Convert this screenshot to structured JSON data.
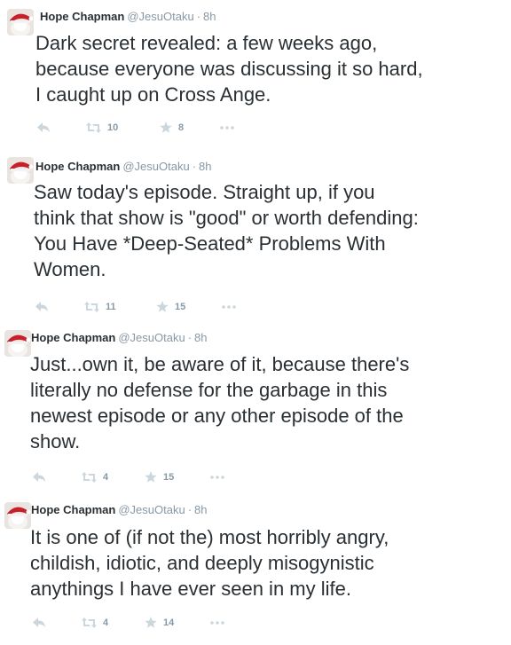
{
  "tweets": [
    {
      "name": "Hope Chapman",
      "handle": "@JesuOtaku",
      "dot": "·",
      "time": "8h",
      "text": "Dark secret revealed: a few weeks ago,\nbecause everyone was discussing it so hard,\nI caught up on Cross Ange.",
      "retweets": "10",
      "favorites": "8"
    },
    {
      "name": "Hope Chapman",
      "handle": "@JesuOtaku",
      "dot": "·",
      "time": "8h",
      "text": "Saw today's episode. Straight up, if you\nthink that show is \"good\" or worth defending:\nYou Have *Deep-Seated* Problems With\nWomen.",
      "retweets": "11",
      "favorites": "15"
    },
    {
      "name": "Hope Chapman",
      "handle": "@JesuOtaku",
      "dot": "·",
      "time": "8h",
      "text": "Just...own it, be aware of it, because there's\nliterally no defense for the garbage in this\nnewest episode or any other episode of the\nshow.",
      "retweets": "4",
      "favorites": "15"
    },
    {
      "name": "Hope Chapman",
      "handle": "@JesuOtaku",
      "dot": "·",
      "time": "8h",
      "text": "It is one of (if not the) most horribly angry,\nchildish, idiotic, and deeply misogynistic\nanythings I have ever seen in my life.",
      "retweets": "4",
      "favorites": "14"
    }
  ],
  "icons": {
    "reply": "reply-icon",
    "retweet": "retweet-icon",
    "favorite": "star-icon",
    "more": "more-icon"
  },
  "colors": {
    "text": "#292f33",
    "muted": "#8899a6",
    "icon": "#ccd6dd",
    "avatar_hat": "#c8202a"
  }
}
